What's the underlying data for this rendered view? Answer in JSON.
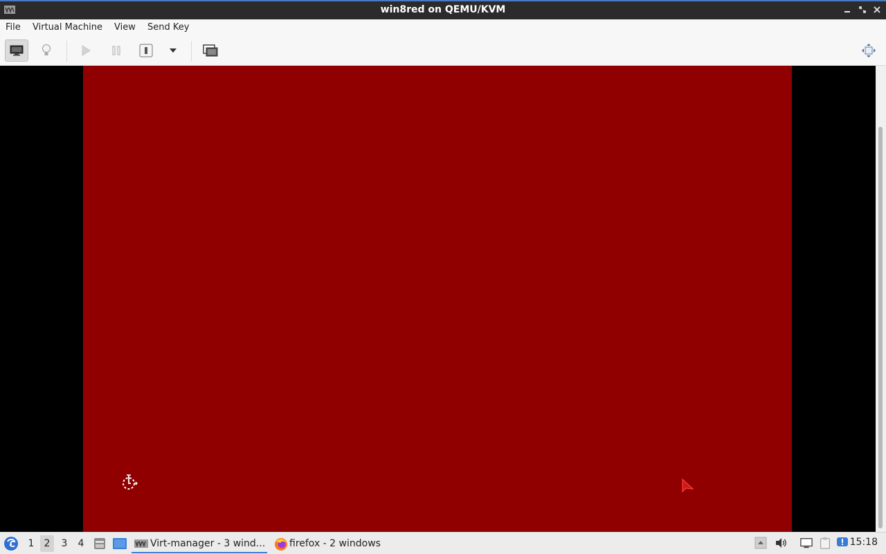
{
  "window": {
    "title": "win8red on QEMU/KVM",
    "controls": [
      "minimize",
      "maximize",
      "close"
    ]
  },
  "menu": {
    "file": "File",
    "virtual_machine": "Virtual Machine",
    "view": "View",
    "send_key": "Send Key"
  },
  "toolbar": {
    "buttons": [
      "console-view",
      "details-view",
      "run",
      "pause",
      "shutdown",
      "shutdown-menu",
      "snapshots",
      "fullscreen"
    ],
    "active": "console-view"
  },
  "guest": {
    "background_color": "#900000"
  },
  "taskbar": {
    "workspaces": [
      "1",
      "2",
      "3",
      "4"
    ],
    "active_workspace": "2",
    "tasks": [
      {
        "label": "Virt-manager - 3 wind...",
        "active": true
      },
      {
        "label": "firefox - 2 windows",
        "active": false
      }
    ],
    "clock": "15:18"
  }
}
